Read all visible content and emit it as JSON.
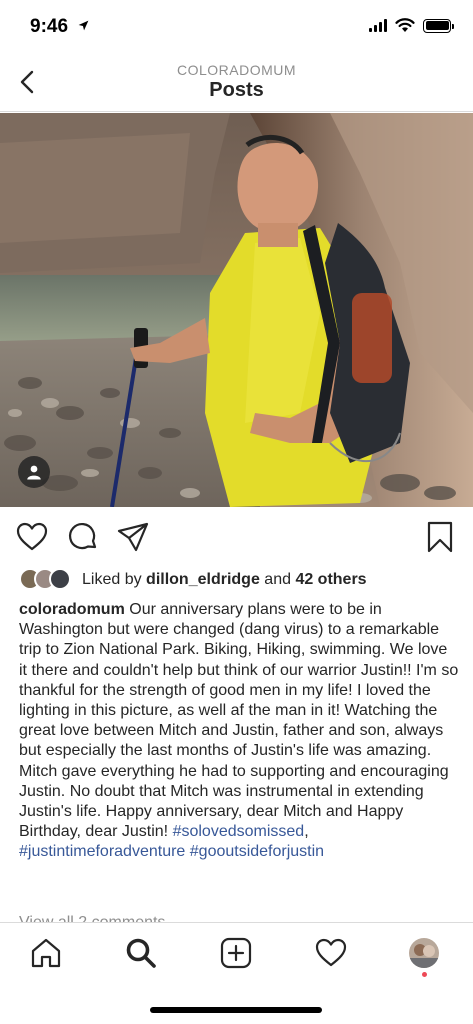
{
  "status_bar": {
    "time": "9:46",
    "icons": [
      "location-arrow-icon",
      "cellular-signal-icon",
      "wifi-icon",
      "battery-icon"
    ]
  },
  "header": {
    "subtitle": "COLORADOMUM",
    "title": "Posts",
    "back_icon": "chevron-left-icon"
  },
  "post": {
    "photo": "Man in yellow shirt with backpack and hiking pole in a slot canyon by a river",
    "tagged_icon": "person-icon",
    "actions": [
      "heart-icon",
      "comment-icon",
      "share-icon",
      "bookmark-icon"
    ],
    "likes": {
      "prefix": "Liked by ",
      "user": "dillon_eldridge",
      "middle": " and ",
      "others": "42 others"
    },
    "caption": {
      "username": "coloradomum",
      "text": " Our anniversary plans were to be in Washington but were changed (dang virus) to a remarkable trip to Zion National Park. Biking, Hiking, swimming. We love it there and couldn't help but think of our warrior Justin!! I'm so thankful for the strength of good men in my life!  I loved the lighting in this picture, as well af the man in it!  Watching the great love between Mitch and Justin, father and son, always but especially the last months of Justin's life was amazing. Mitch gave everything he had to supporting and encouraging Justin.  No doubt that Mitch was instrumental in extending Justin's life. Happy anniversary, dear Mitch and Happy Birthday, dear Justin! ",
      "hashtag1": "#solovedsomissed",
      "sep1": ",",
      "hashtag2": "#justintimeforadventure",
      "sep2": " ",
      "hashtag3": "#gooutsideforjustin"
    },
    "view_comments": "View all 2 comments"
  },
  "tab_bar": {
    "items": [
      "home-icon",
      "search-icon",
      "new-post-icon",
      "activity-heart-icon",
      "profile-avatar"
    ]
  },
  "colors": {
    "hashtag": "#385898",
    "secondary_text": "#8e8e8e",
    "notification_dot": "#ed4956"
  }
}
